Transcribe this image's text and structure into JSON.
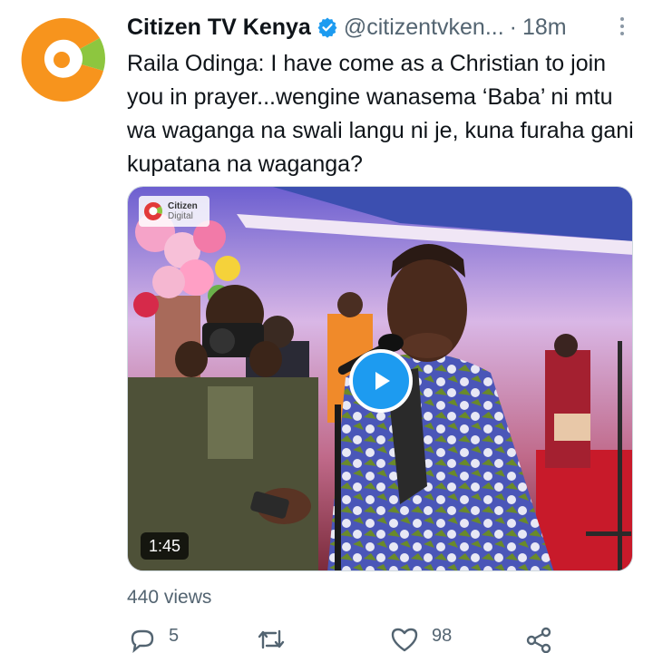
{
  "account": {
    "display_name": "Citizen TV Kenya",
    "handle": "@citizentvken...",
    "separator": "·",
    "time": "18m",
    "verified": true
  },
  "tweet": {
    "text": "Raila Odinga: I have come as a Christian to join you in prayer...wengine wanasema ‘Baba’ ni mtu wa waganga na swali langu ni je, kuna furaha gani kupatana na waganga?"
  },
  "video": {
    "duration": "1:45",
    "watermark_line1": "Citizen",
    "watermark_line2": "Digital"
  },
  "views": "440 views",
  "actions": {
    "reply_count": "5",
    "retweet_count": "",
    "like_count": "98"
  },
  "colors": {
    "brand_orange": "#f7941d",
    "brand_green": "#8dc63f",
    "verified_blue": "#1d9bf0",
    "text_primary": "#0f1419",
    "text_secondary": "#536471"
  },
  "icons": {
    "avatar": "citizen-tv-logo",
    "verified": "verified-badge-icon",
    "more": "more-vertical-icon",
    "play": "play-icon",
    "reply": "reply-icon",
    "retweet": "retweet-icon",
    "like": "heart-icon",
    "share": "share-icon"
  }
}
